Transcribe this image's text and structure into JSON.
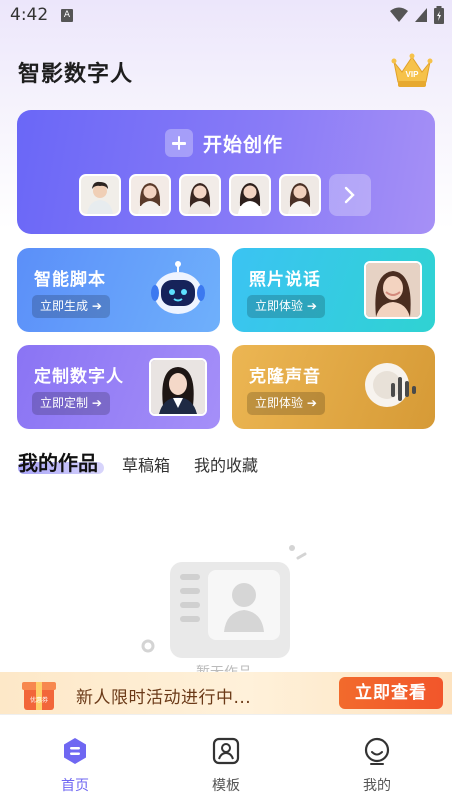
{
  "status_bar": {
    "time": "4:42",
    "notification_letter": "A"
  },
  "header": {
    "title": "智影数字人",
    "vip_badge": "VIP"
  },
  "start_banner": {
    "label": "开始创作",
    "avatars": [
      "avatar-male-1",
      "avatar-female-1",
      "avatar-female-2",
      "avatar-female-3",
      "avatar-female-4"
    ]
  },
  "features": [
    {
      "title": "智能脚本",
      "button": "立即生成 ➔",
      "gradient": [
        "#5b8ff9",
        "#6aa8fb"
      ],
      "art": "robot-icon"
    },
    {
      "title": "照片说话",
      "button": "立即体验 ➔",
      "gradient": [
        "#3fc9f2",
        "#2fd0d6"
      ],
      "art": "portrait-photo"
    },
    {
      "title": "定制数字人",
      "button": "立即定制 ➔",
      "gradient": [
        "#8c78f5",
        "#a08bf8"
      ],
      "art": "portrait-photo"
    },
    {
      "title": "克隆声音",
      "button": "立即体验 ➔",
      "gradient": [
        "#e9b04d",
        "#d89a35"
      ],
      "art": "sound-wave-icon"
    }
  ],
  "tabs": [
    {
      "label": "我的作品",
      "active": true
    },
    {
      "label": "草稿箱",
      "active": false
    },
    {
      "label": "我的收藏",
      "active": false
    }
  ],
  "empty_state": {
    "text": "暂无作品"
  },
  "promo": {
    "badge": "优惠券",
    "text": "新人限时活动进行中...",
    "button": "立即查看"
  },
  "bottom_nav": [
    {
      "label": "首页",
      "icon": "home-icon",
      "active": true
    },
    {
      "label": "模板",
      "icon": "template-icon",
      "active": false
    },
    {
      "label": "我的",
      "icon": "profile-icon",
      "active": false
    }
  ],
  "colors": {
    "accent": "#6f67f2",
    "promo_button": "#f2562b"
  }
}
